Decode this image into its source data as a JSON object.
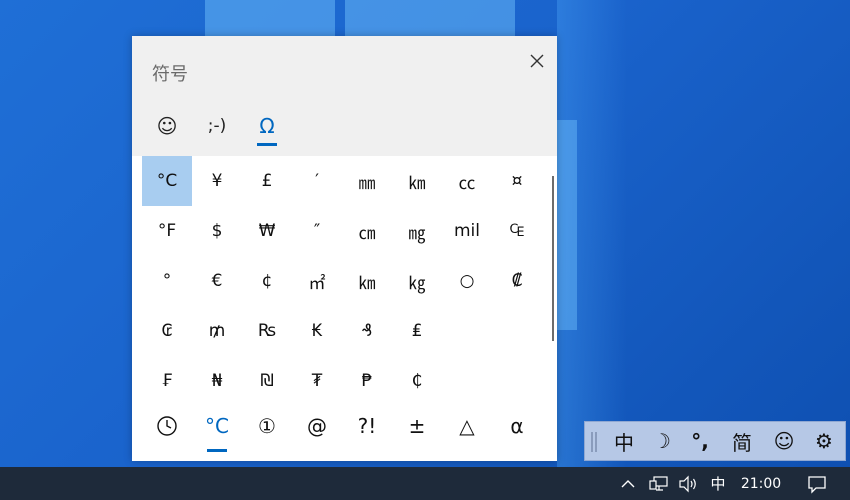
{
  "colors": {
    "accent": "#0067c0",
    "selected_cell": "#a8cdf0",
    "taskbar": "#1e2a3a",
    "ime_bar": "#b6c8e6"
  },
  "symbol_panel": {
    "title": "符号",
    "close_icon": "close-icon",
    "tabs": [
      {
        "label": "☺",
        "icon": "emoji-icon"
      },
      {
        "label": ";-)",
        "icon": "kaomoji-icon"
      },
      {
        "label": "Ω",
        "icon": "symbols-icon",
        "active": true
      }
    ],
    "grid": [
      [
        "°C",
        "¥",
        "£",
        "′",
        "㎜",
        "㎞",
        "㏄",
        "¤"
      ],
      [
        "°F",
        "$",
        "₩",
        "″",
        "㎝",
        "㎎",
        "mil",
        "₠"
      ],
      [
        "°",
        "€",
        "¢",
        "㎡",
        "㎞",
        "㎏",
        "○",
        "₡"
      ],
      [
        "₢",
        "₥",
        "₨",
        "₭",
        "₰",
        "₤"
      ],
      [
        "₣",
        "₦",
        "₪",
        "₮",
        "₱",
        "₵"
      ]
    ],
    "categories": [
      {
        "label": "🕒",
        "icon": "clock-icon"
      },
      {
        "label": "°C",
        "icon": "units-icon",
        "active": true
      },
      {
        "label": "①",
        "icon": "enclosed-number-icon"
      },
      {
        "label": "@",
        "icon": "at-icon"
      },
      {
        "label": "?!",
        "icon": "punctuation-icon"
      },
      {
        "label": "±",
        "icon": "math-icon"
      },
      {
        "label": "△",
        "icon": "shapes-icon"
      },
      {
        "label": "α",
        "icon": "greek-icon"
      }
    ]
  },
  "ime_toolbar": {
    "items": [
      {
        "label": "中",
        "icon": "chinese-mode"
      },
      {
        "label": "☽",
        "icon": "half-width-moon-icon"
      },
      {
        "label": "°,",
        "icon": "punctuation-mode-icon"
      },
      {
        "label": "简",
        "icon": "simplified-icon"
      },
      {
        "label": "☺",
        "icon": "emoji-icon"
      },
      {
        "label": "⚙",
        "icon": "settings-gear-icon"
      }
    ]
  },
  "taskbar": {
    "chevron": "^",
    "ime_indicator": "中",
    "time": "21:00"
  }
}
